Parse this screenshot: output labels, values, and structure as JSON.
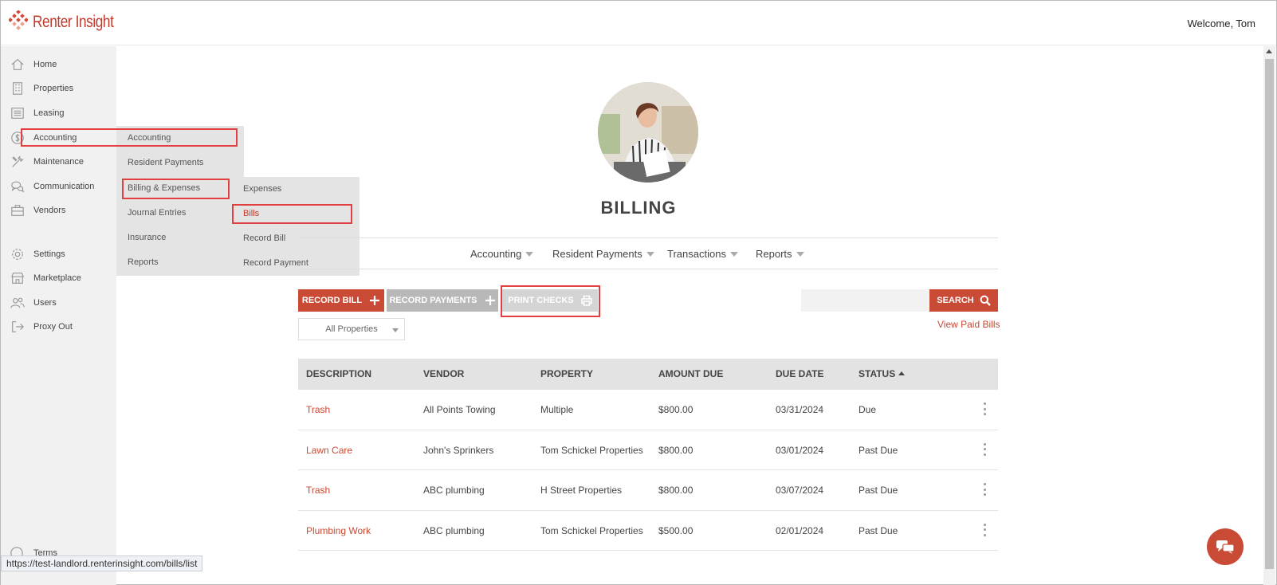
{
  "brand": {
    "name": "Renter Insight",
    "accent": "#c94a35"
  },
  "header": {
    "welcome": "Welcome, Tom"
  },
  "sidebar": {
    "items": [
      {
        "label": "Home",
        "icon": "home-icon"
      },
      {
        "label": "Properties",
        "icon": "building-icon"
      },
      {
        "label": "Leasing",
        "icon": "list-icon"
      },
      {
        "label": "Accounting",
        "icon": "dollar-icon"
      },
      {
        "label": "Maintenance",
        "icon": "tools-icon"
      },
      {
        "label": "Communication",
        "icon": "chat-bubbles-icon"
      },
      {
        "label": "Vendors",
        "icon": "briefcase-icon"
      },
      {
        "label": "Settings",
        "icon": "gear-icon"
      },
      {
        "label": "Marketplace",
        "icon": "store-icon"
      },
      {
        "label": "Users",
        "icon": "users-icon"
      },
      {
        "label": "Proxy Out",
        "icon": "sign-out-icon"
      }
    ],
    "terms": "Terms"
  },
  "accounting_menu": {
    "items": [
      "Accounting",
      "Resident Payments",
      "Billing & Expenses",
      "Journal Entries",
      "Insurance",
      "Reports"
    ]
  },
  "billing_menu": {
    "items": [
      "Expenses",
      "Bills",
      "Record Bill",
      "Record Payment"
    ],
    "active": "Bills"
  },
  "page": {
    "title": "BILLING",
    "tabs": [
      "Accounting",
      "Resident Payments",
      "Transactions",
      "Reports"
    ]
  },
  "toolbar": {
    "record_bill": "RECORD BILL",
    "record_payments": "RECORD PAYMENTS",
    "print_checks": "PRINT CHECKS",
    "search_label": "SEARCH",
    "search_value": "",
    "view_paid": "View Paid Bills",
    "property_filter": "All Properties"
  },
  "table": {
    "headers": [
      "DESCRIPTION",
      "VENDOR",
      "PROPERTY",
      "AMOUNT DUE",
      "DUE DATE",
      "STATUS"
    ],
    "sorted_column": "STATUS",
    "rows": [
      {
        "description": "Trash",
        "vendor": "All Points Towing",
        "property": "Multiple",
        "amount": "$800.00",
        "due": "03/31/2024",
        "status": "Due"
      },
      {
        "description": "Lawn Care",
        "vendor": "John's Sprinkers",
        "property": "Tom Schickel Properties",
        "amount": "$800.00",
        "due": "03/01/2024",
        "status": "Past Due"
      },
      {
        "description": "Trash",
        "vendor": "ABC plumbing",
        "property": "H Street Properties",
        "amount": "$800.00",
        "due": "03/07/2024",
        "status": "Past Due"
      },
      {
        "description": "Plumbing Work",
        "vendor": "ABC plumbing",
        "property": "Tom Schickel Properties",
        "amount": "$500.00",
        "due": "02/01/2024",
        "status": "Past Due"
      }
    ]
  },
  "browser": {
    "status_url": "https://test-landlord.renterinsight.com/bills/list"
  }
}
